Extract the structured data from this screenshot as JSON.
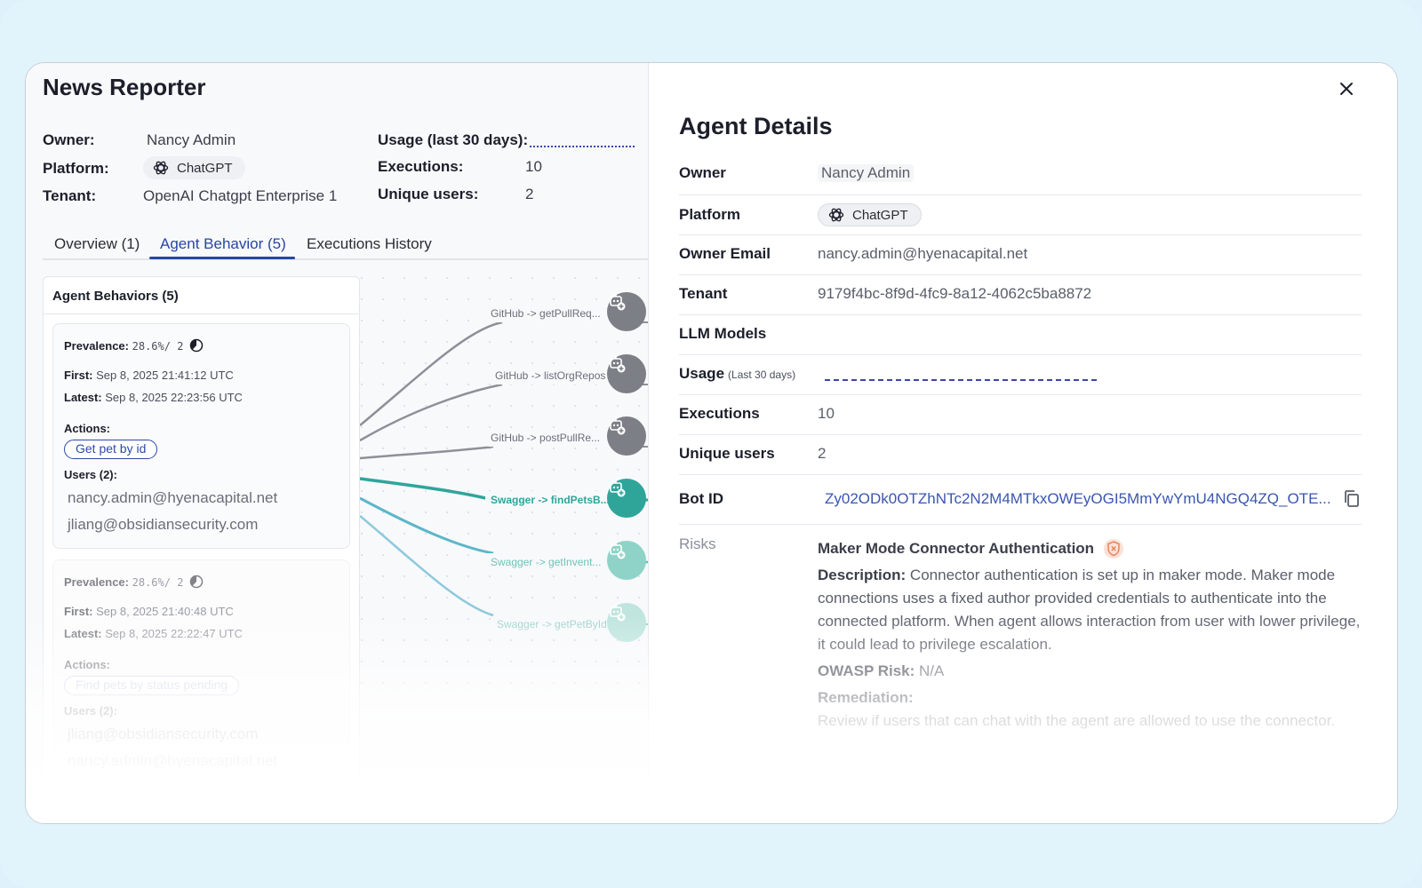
{
  "app": {
    "title": "News Reporter"
  },
  "summary": {
    "owner_label": "Owner:",
    "owner": "Nancy Admin",
    "platform_label": "Platform:",
    "platform": "ChatGPT",
    "tenant_label": "Tenant:",
    "tenant": "OpenAI Chatgpt Enterprise 1",
    "usage_label": "Usage (last 30 days):",
    "executions_label": "Executions:",
    "executions": "10",
    "unique_users_label": "Unique users:",
    "unique_users": "2"
  },
  "tabs": [
    {
      "label": "Overview (1)",
      "active": false
    },
    {
      "label": "Agent Behavior (5)",
      "active": true
    },
    {
      "label": "Executions History",
      "active": false
    }
  ],
  "behaviors": {
    "header": "Agent Behaviors (5)",
    "cards": [
      {
        "prevalence_label": "Prevalence:",
        "prevalence": "28.6%/ 2",
        "first_label": "First:",
        "first": "Sep 8, 2025 21:41:12 UTC",
        "latest_label": "Latest:",
        "latest": "Sep 8, 2025 22:23:56 UTC",
        "actions_label": "Actions:",
        "action": "Get pet by id",
        "users_label": "Users (2):",
        "users": [
          "nancy.admin@hyenacapital.net",
          "jliang@obsidiansecurity.com"
        ]
      },
      {
        "prevalence_label": "Prevalence:",
        "prevalence": "28.6%/ 2",
        "first_label": "First:",
        "first": "Sep 8, 2025 21:40:48 UTC",
        "latest_label": "Latest:",
        "latest": "Sep 8, 2025 22:22:47 UTC",
        "actions_label": "Actions:",
        "action": "Find pets by status pending",
        "users_label": "Users (2):",
        "users": [
          "jliang@obsidiansecurity.com",
          "nancy.admin@hyenacapital.net"
        ]
      }
    ]
  },
  "graph_nodes": [
    {
      "label": "GitHub -> getPullReq...",
      "kind": "github"
    },
    {
      "label": "GitHub -> listOrgRepos",
      "kind": "github"
    },
    {
      "label": "GitHub -> postPullRe...",
      "kind": "github"
    },
    {
      "label": "Swagger -> findPetsB...",
      "kind": "swagger"
    },
    {
      "label": "Swagger -> getInvent...",
      "kind": "swagger"
    },
    {
      "label": "Swagger -> getPetById",
      "kind": "swagger"
    }
  ],
  "details": {
    "title": "Agent Details",
    "owner_label": "Owner",
    "owner": "Nancy Admin",
    "platform_label": "Platform",
    "platform": "ChatGPT",
    "owner_email_label": "Owner Email",
    "owner_email": "nancy.admin@hyenacapital.net",
    "tenant_label": "Tenant",
    "tenant": "9179f4bc-8f9d-4fc9-8a12-4062c5ba8872",
    "llm_models_label": "LLM Models",
    "usage_label": "Usage",
    "usage_sub": "(Last 30 days)",
    "executions_label": "Executions",
    "executions": "10",
    "unique_users_label": "Unique users",
    "unique_users": "2",
    "bot_id_label": "Bot ID",
    "bot_id": "Zy02ODk0OTZhNTc2N2M4MTkxOWEyOGI5MmYwYmU4NGQ4ZQ_OTE...",
    "risks_label": "Risks",
    "risk": {
      "title": "Maker Mode Connector Authentication",
      "description_label": "Description:",
      "description": "Connector authentication is set up in maker mode. Maker mode connections uses a fixed author provided credentials to authenticate into the connected platform. When agent allows interaction from user with lower privilege, it could lead to privilege escalation.",
      "owasp_label": "OWASP Risk:",
      "owasp": "N/A",
      "remediation_label": "Remediation:",
      "remediation": "Review if users that can chat with the agent are allowed to use the connector."
    }
  },
  "colors": {
    "accent": "#2746a3",
    "github_node": "#7d7f86",
    "swagger_node": "#2fa59a",
    "risk_badge": "#f0a787",
    "link": "#3a56b0"
  }
}
